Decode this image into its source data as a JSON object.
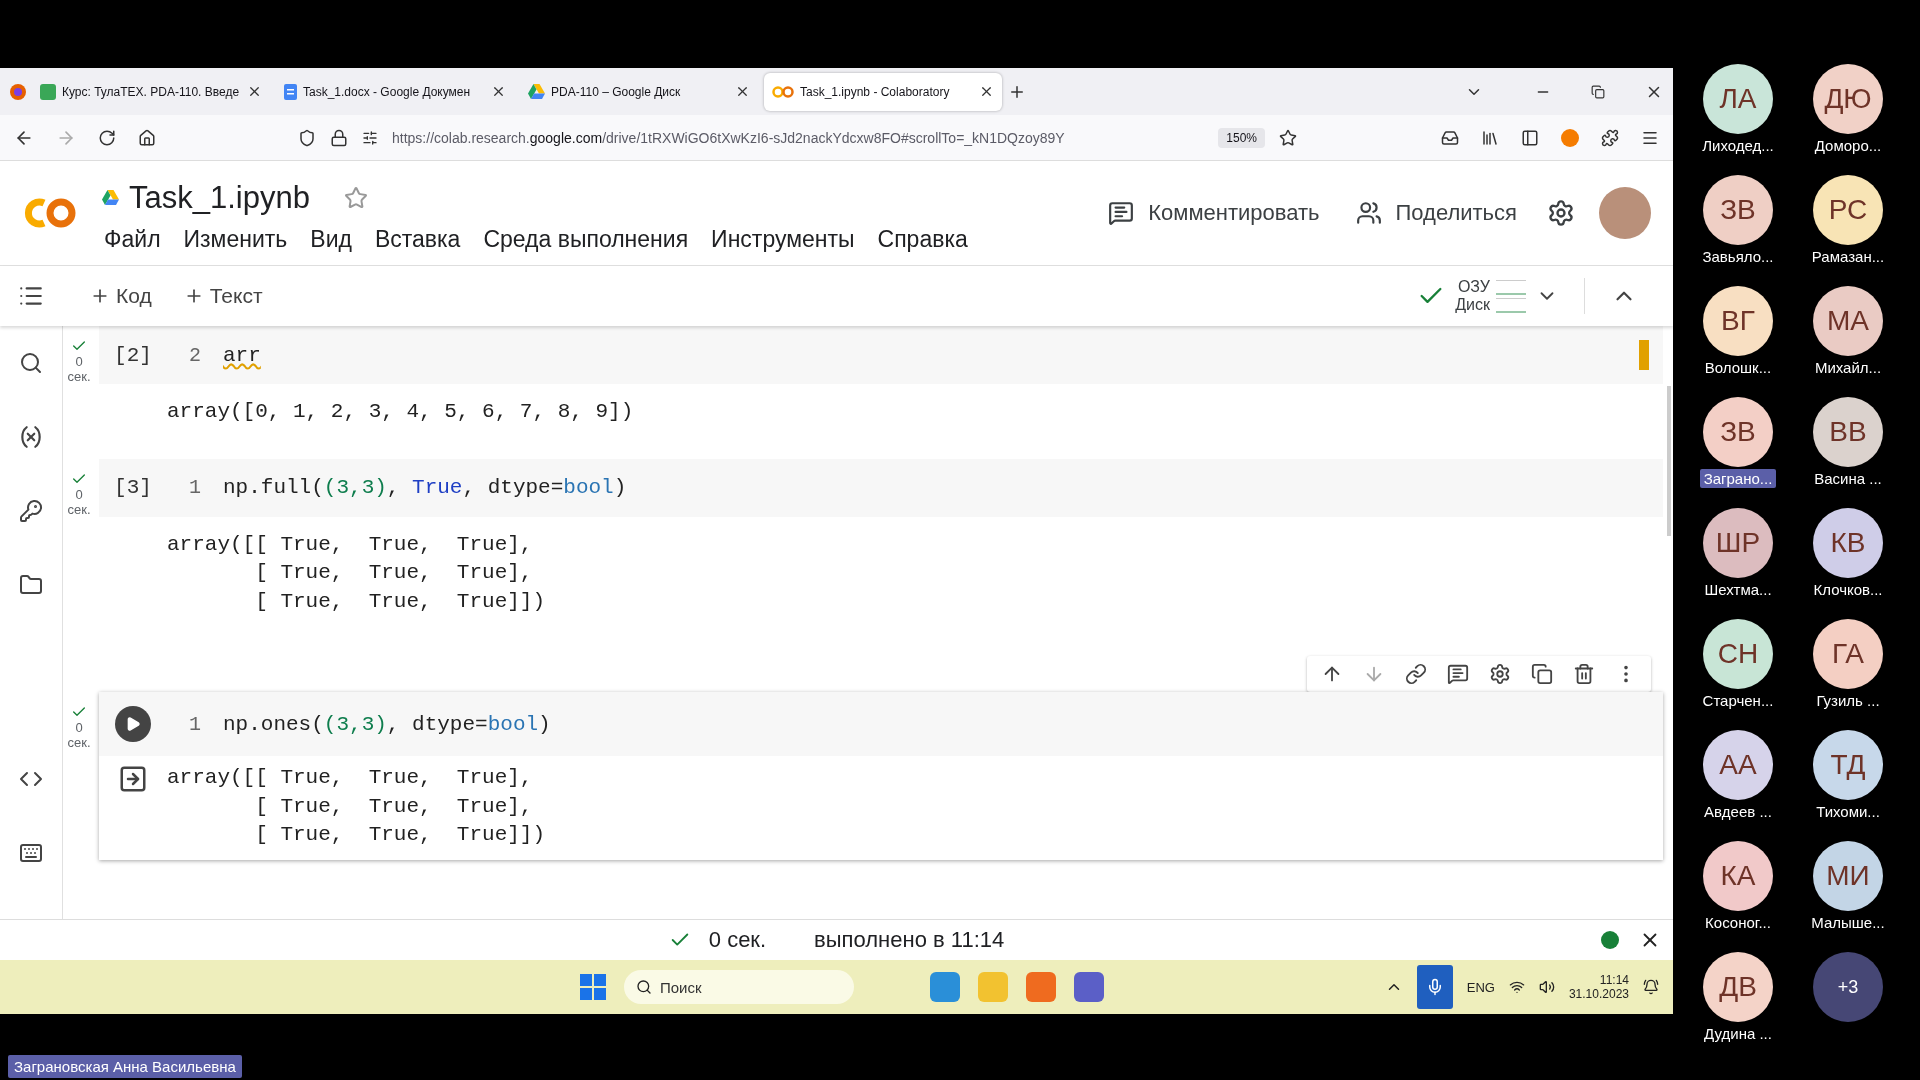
{
  "browser": {
    "tabs": [
      {
        "title": "Курс: ТулаТЕХ. PDA-110. Введе",
        "kind": "course",
        "selected": false
      },
      {
        "title": "Task_1.docx - Google Докумен",
        "kind": "docs",
        "selected": false
      },
      {
        "title": "PDA-110 – Google Диск",
        "kind": "drive",
        "selected": false
      },
      {
        "title": "Task_1.ipynb - Colaboratory",
        "kind": "colab",
        "selected": true
      }
    ],
    "url": "https://colab.research.**google.com**/drive/1tRXWiGO6tXwKzI6-sJd2nackYdcxw8FO#scrollTo=_kN1DQzoy89Y",
    "zoom": "150%"
  },
  "notebook": {
    "title": "Task_1.ipynb",
    "menu": [
      "Файл",
      "Изменить",
      "Вид",
      "Вставка",
      "Среда выполнения",
      "Инструменты",
      "Справка"
    ],
    "comment": "Комментировать",
    "share": "Поделиться",
    "add_code": "Код",
    "add_text": "Текст",
    "ram": "ОЗУ",
    "disk": "Диск"
  },
  "cells": [
    {
      "count": "[2]",
      "focused": false,
      "duration": "0",
      "unit": "сек.",
      "line": "2",
      "code": [
        {
          "text": "arr",
          "kind": "lint"
        }
      ],
      "output": [
        "array([0, 1, 2, 3, 4, 5, 6, 7, 8, 9])"
      ]
    },
    {
      "count": "[3]",
      "focused": false,
      "duration": "0",
      "unit": "сек.",
      "line": "1",
      "code": [
        {
          "text": "np.full(",
          "kind": "plain"
        },
        {
          "text": "(3,3)",
          "kind": "paren"
        },
        {
          "text": ", ",
          "kind": "plain"
        },
        {
          "text": "True",
          "kind": "const"
        },
        {
          "text": ", dtype=",
          "kind": "plain"
        },
        {
          "text": "bool",
          "kind": "type"
        },
        {
          "text": ")",
          "kind": "plain"
        }
      ],
      "output": [
        "array([[ True,  True,  True],",
        "       [ True,  True,  True],",
        "       [ True,  True,  True]])"
      ]
    },
    {
      "focused": true,
      "duration": "0",
      "unit": "сек.",
      "line": "1",
      "code": [
        {
          "text": "np.ones(",
          "kind": "plain"
        },
        {
          "text": "(3,3)",
          "kind": "paren"
        },
        {
          "text": ", dtype=",
          "kind": "plain"
        },
        {
          "text": "bool",
          "kind": "type"
        },
        {
          "text": ")",
          "kind": "plain"
        }
      ],
      "output": [
        "array([[ True,  True,  True],",
        "       [ True,  True,  True],",
        "       [ True,  True,  True]])"
      ]
    }
  ],
  "status_bar": {
    "duration": "0 сек.",
    "message": "выполнено в 11:14"
  },
  "taskbar": {
    "search_placeholder": "Поиск",
    "language": "ENG",
    "time": "11:14",
    "date": "31.10.2023"
  },
  "participants": [
    {
      "kind": "person",
      "initials": "ЛА",
      "name": "Лиходед...",
      "color": "#c9e5d9",
      "selected": false
    },
    {
      "kind": "person",
      "initials": "ДЮ",
      "name": "Доморо...",
      "color": "#f1d1c7",
      "selected": false
    },
    {
      "kind": "person",
      "initials": "ЗВ",
      "name": "Завьяло...",
      "color": "#efcfc5",
      "selected": false
    },
    {
      "kind": "person",
      "initials": "РС",
      "name": "Рамазан...",
      "color": "#f8e4b5",
      "selected": false
    },
    {
      "kind": "person",
      "initials": "ВГ",
      "name": "Волошк...",
      "color": "#f8dfc2",
      "selected": false
    },
    {
      "kind": "person",
      "initials": "МА",
      "name": "Михайл...",
      "color": "#eacbc4",
      "selected": false
    },
    {
      "kind": "person",
      "initials": "ЗВ",
      "name": "Заграно...",
      "color": "#f3cfc6",
      "selected": true
    },
    {
      "kind": "person",
      "initials": "ВВ",
      "name": "Васина ...",
      "color": "#dbd2cd",
      "selected": false
    },
    {
      "kind": "person",
      "initials": "ШР",
      "name": "Шехтма...",
      "color": "#dcbcbf",
      "selected": false
    },
    {
      "kind": "person",
      "initials": "КВ",
      "name": "Клочков...",
      "color": "#cfcde8",
      "selected": false
    },
    {
      "kind": "person",
      "initials": "СН",
      "name": "Старчен...",
      "color": "#c8e5d6",
      "selected": false
    },
    {
      "kind": "person",
      "initials": "ГА",
      "name": "Гузиль ...",
      "color": "#f4cfc3",
      "selected": false
    },
    {
      "kind": "person",
      "initials": "АА",
      "name": "Авдеев ...",
      "color": "#d6d3ea",
      "selected": false
    },
    {
      "kind": "person",
      "initials": "ТД",
      "name": "Тихоми...",
      "color": "#c7d8ea",
      "selected": false
    },
    {
      "kind": "person",
      "initials": "КА",
      "name": "Косоног...",
      "color": "#f1c9c9",
      "selected": false
    },
    {
      "kind": "person",
      "initials": "МИ",
      "name": "Малыше...",
      "color": "#c3d5e6",
      "selected": false
    },
    {
      "kind": "person",
      "initials": "ДВ",
      "name": "Дудина ...",
      "color": "#f4d3c8",
      "selected": false
    },
    {
      "kind": "more",
      "initials": "+3",
      "color": "#464775"
    }
  ],
  "presenter": "Заграновская Анна Васильевна"
}
